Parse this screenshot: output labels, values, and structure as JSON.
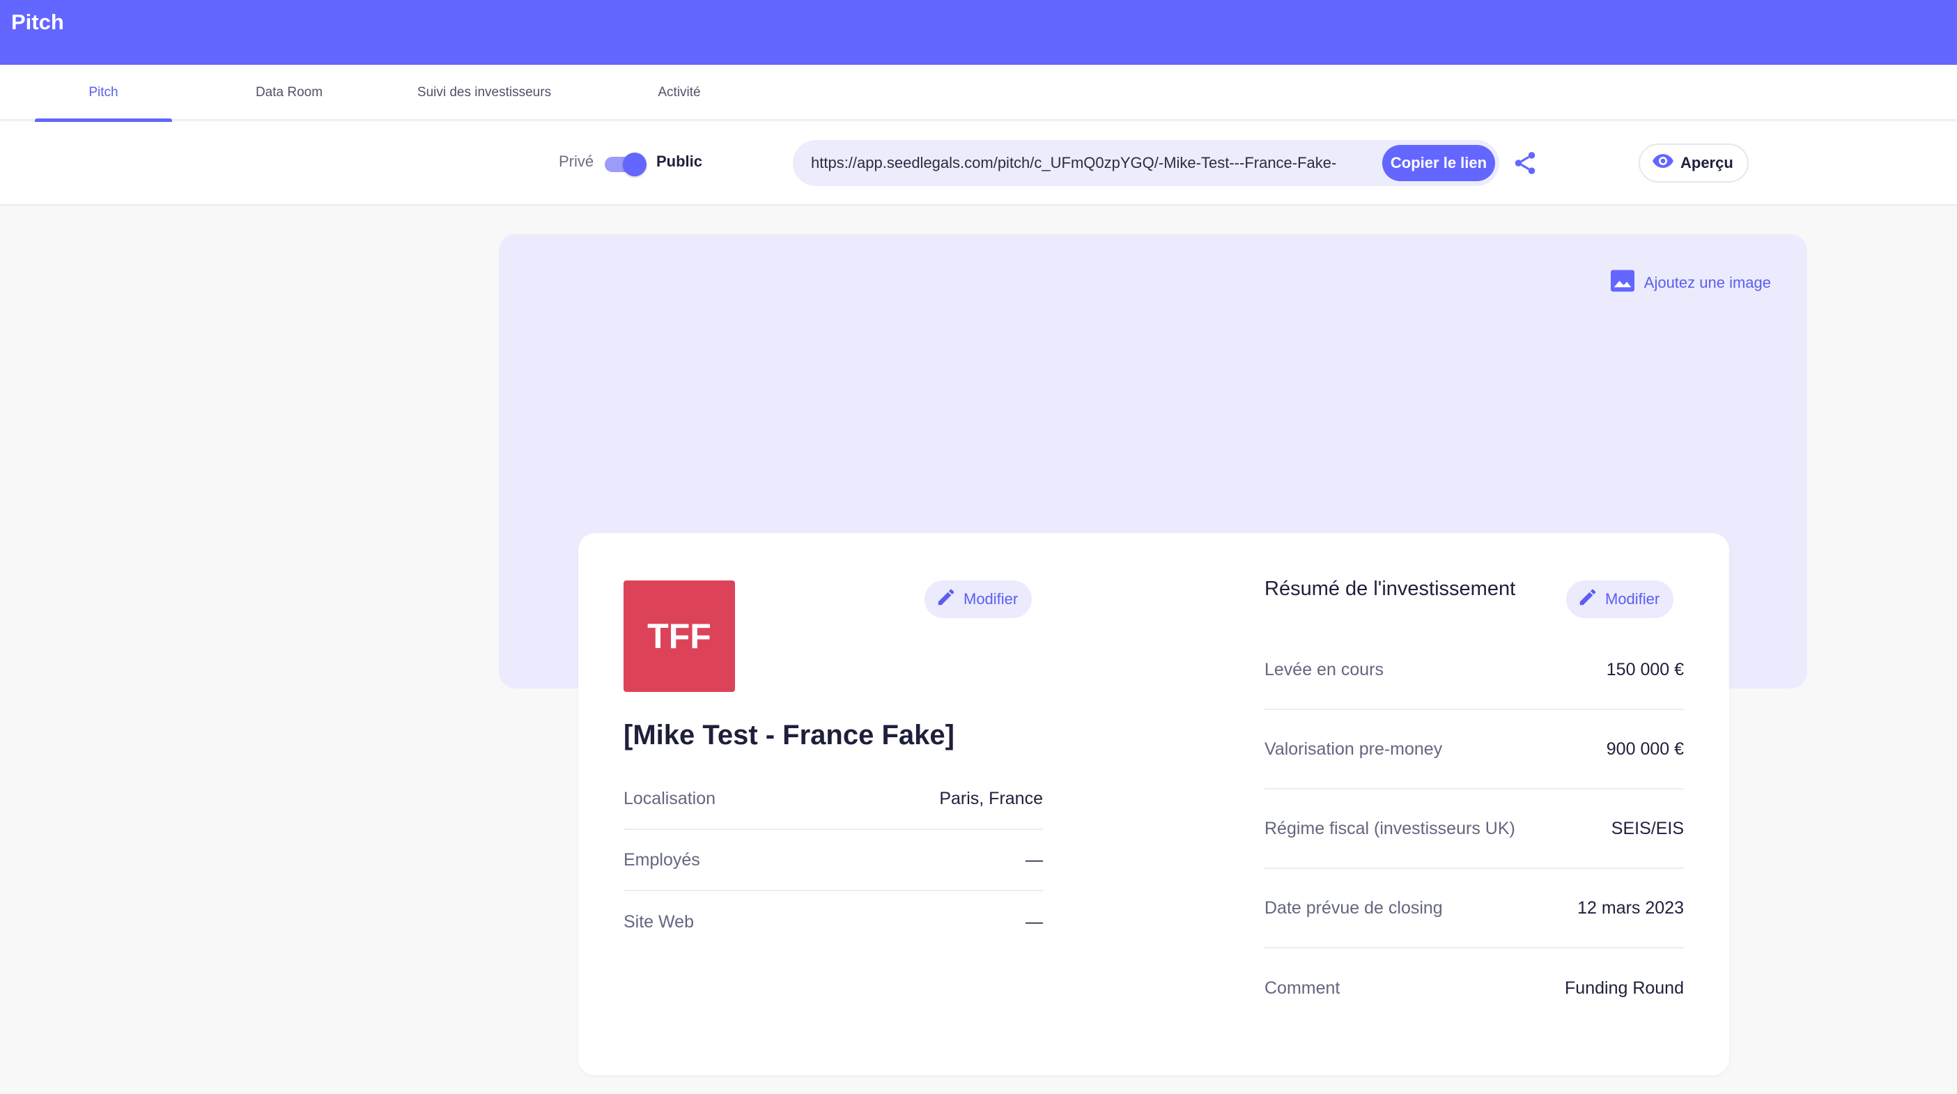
{
  "header": {
    "title": "Pitch",
    "bg_color": "#6366ff"
  },
  "tabs": [
    {
      "label": "Pitch",
      "active": true
    },
    {
      "label": "Data Room",
      "active": false
    },
    {
      "label": "Suivi des investisseurs",
      "active": false
    },
    {
      "label": "Activité",
      "active": false
    }
  ],
  "share": {
    "visibility_off_label": "Privé",
    "visibility_on_label": "Public",
    "visibility_public": true,
    "url": "https://app.seedlegals.com/pitch/c_UFmQ0zpYGQ/-Mike-Test---France-Fake-",
    "copy_label": "Copier le lien",
    "preview_label": "Aperçu",
    "share_icon": "share-icon",
    "preview_icon": "eye-icon"
  },
  "cover": {
    "add_image_label": "Ajoutez une image",
    "add_image_icon": "image-icon"
  },
  "company": {
    "logo_text": "TFF",
    "logo_color": "#dc4359",
    "edit_label": "Modifier",
    "name": "[Mike Test - France Fake]",
    "details": [
      {
        "label": "Localisation",
        "value": "Paris, France"
      },
      {
        "label": "Employés",
        "value": "—"
      },
      {
        "label": "Site Web",
        "value": "—"
      }
    ]
  },
  "investment": {
    "title": "Résumé de l'investissement",
    "edit_label": "Modifier",
    "rows": [
      {
        "label": "Levée en cours",
        "value": "150 000 €"
      },
      {
        "label": "Valorisation pre-money",
        "value": "900 000 €"
      },
      {
        "label": "Régime fiscal (investisseurs UK)",
        "value": "SEIS/EIS"
      },
      {
        "label": "Date prévue de closing",
        "value": "12 mars 2023"
      },
      {
        "label": "Comment",
        "value": "Funding Round"
      }
    ]
  },
  "colors": {
    "accent": "#6366ff",
    "accent_light": "#ebebfd"
  }
}
